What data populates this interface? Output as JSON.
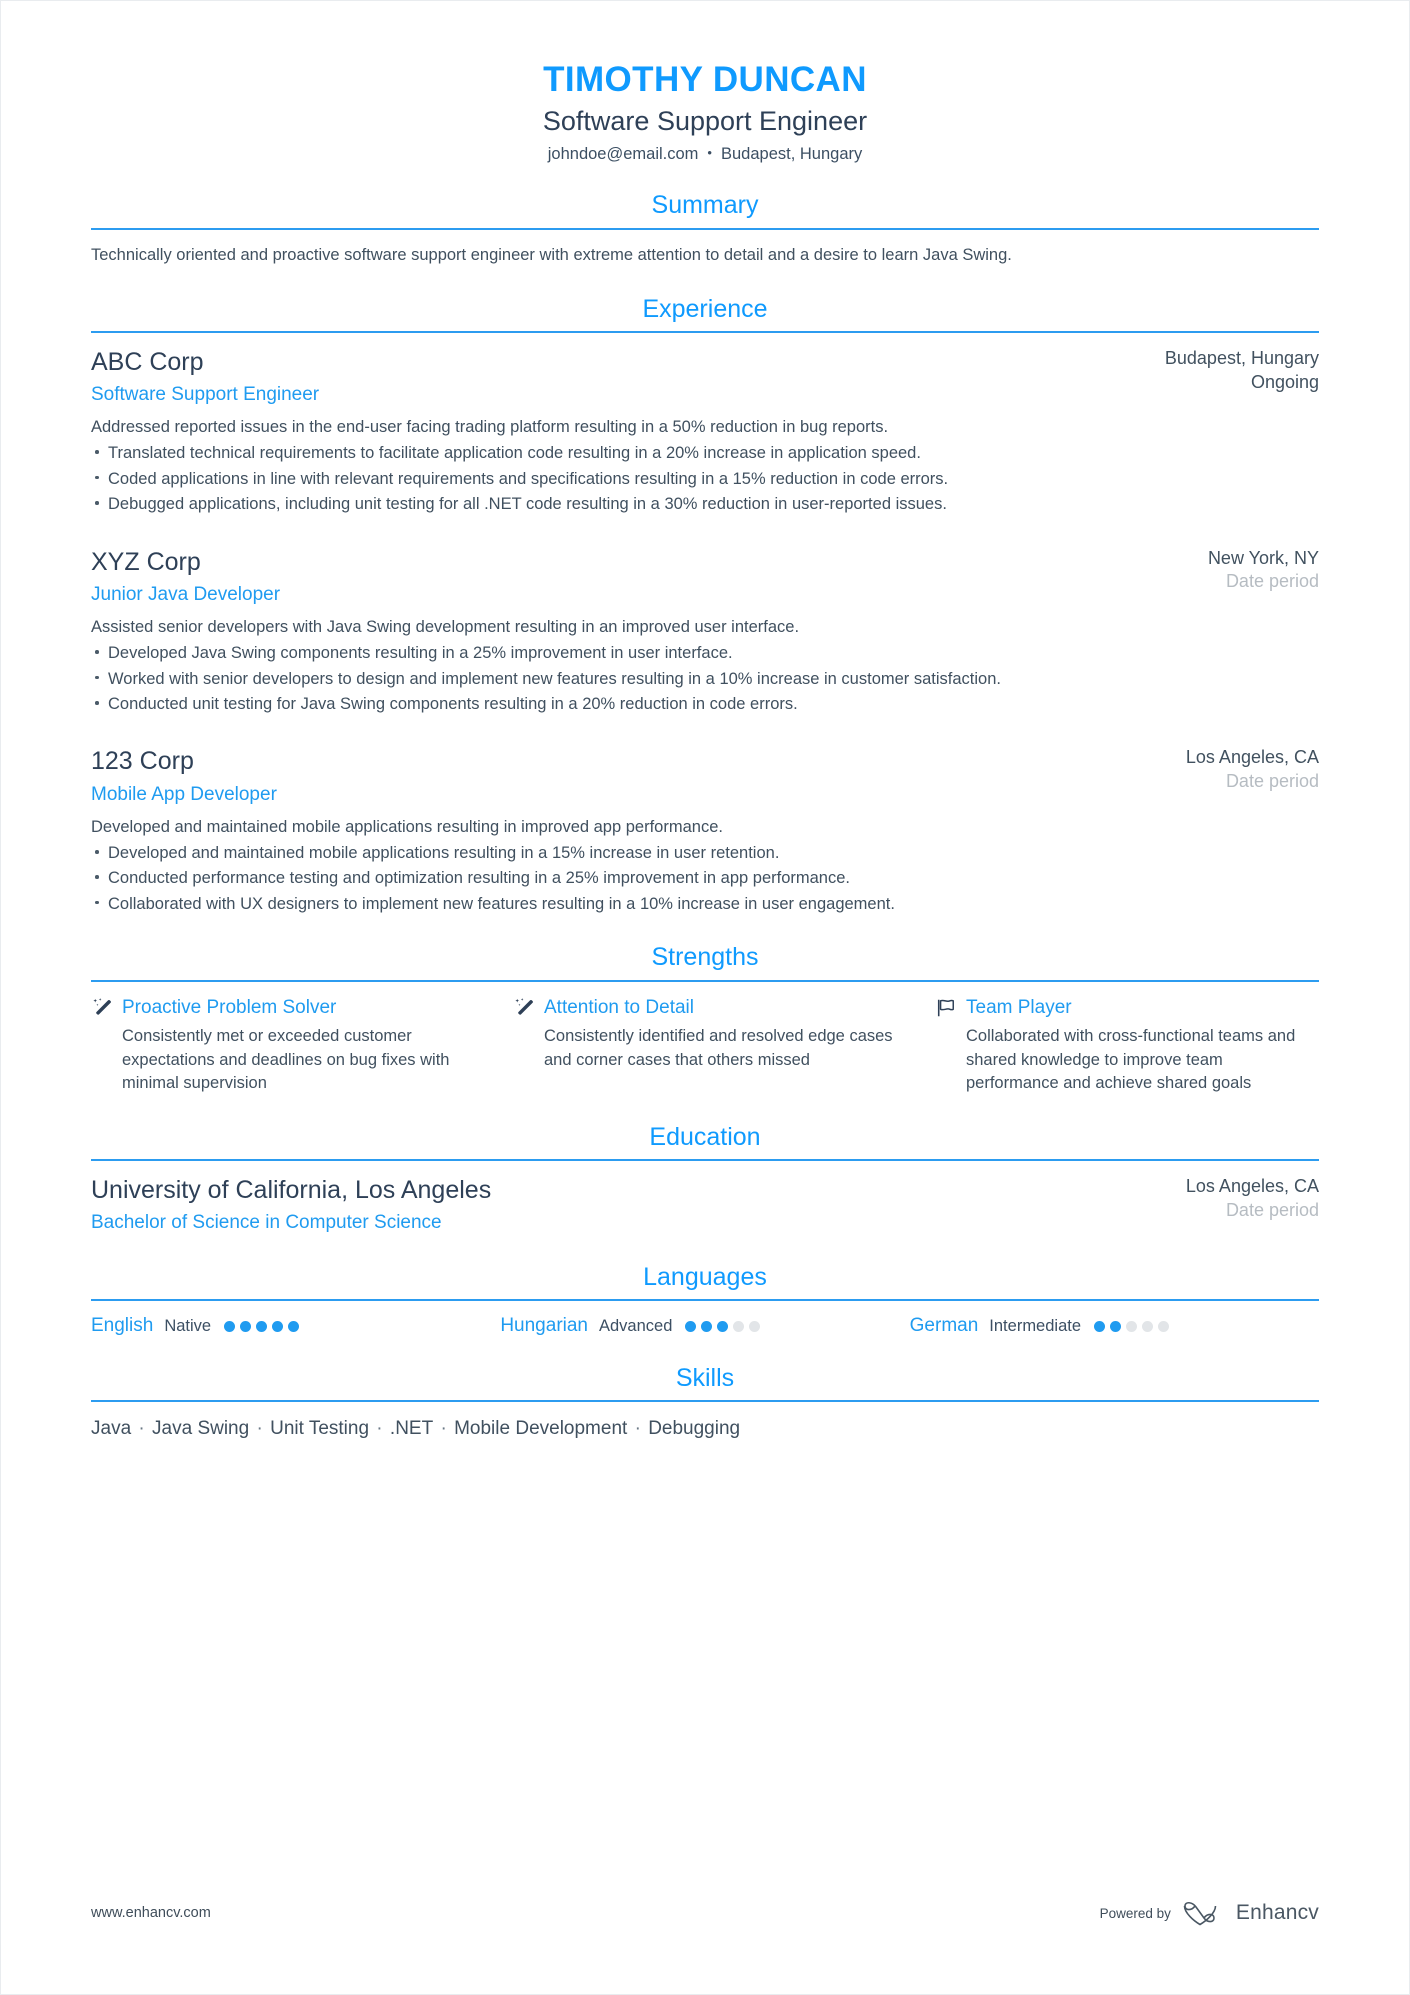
{
  "header": {
    "name": "TIMOTHY DUNCAN",
    "role": "Software Support Engineer",
    "email": "johndoe@email.com",
    "separator": "•",
    "location": "Budapest, Hungary"
  },
  "sections": {
    "summary": "Summary",
    "experience": "Experience",
    "strengths": "Strengths",
    "education": "Education",
    "languages": "Languages",
    "skills": "Skills"
  },
  "summary": {
    "text": "Technically oriented and proactive software support engineer with extreme attention to detail and a desire to learn Java Swing."
  },
  "experience": [
    {
      "org": "ABC Corp",
      "role": "Software Support Engineer",
      "location": "Budapest, Hungary",
      "date": "Ongoing",
      "date_muted": false,
      "desc": "Addressed reported issues in the end-user facing trading platform resulting in a 50% reduction in bug reports.",
      "bullets": [
        "Translated technical requirements to facilitate application code resulting in a 20% increase in application speed.",
        "Coded applications in line with relevant requirements and specifications resulting in a 15% reduction in code errors.",
        "Debugged applications, including unit testing for all .NET code resulting in a 30% reduction in user-reported issues."
      ]
    },
    {
      "org": "XYZ Corp",
      "role": "Junior Java Developer",
      "location": "New York, NY",
      "date": "Date period",
      "date_muted": true,
      "desc": "Assisted senior developers with Java Swing development resulting in an improved user interface.",
      "bullets": [
        "Developed Java Swing components resulting in a 25% improvement in user interface.",
        "Worked with senior developers to design and implement new features resulting in a 10% increase in customer satisfaction.",
        "Conducted unit testing for Java Swing components resulting in a 20% reduction in code errors."
      ]
    },
    {
      "org": "123 Corp",
      "role": "Mobile App Developer",
      "location": "Los Angeles, CA",
      "date": "Date period",
      "date_muted": true,
      "desc": "Developed and maintained mobile applications resulting in improved app performance.",
      "bullets": [
        "Developed and maintained mobile applications resulting in a 15% increase in user retention.",
        "Conducted performance testing and optimization resulting in a 25% improvement in app performance.",
        "Collaborated with UX designers to implement new features resulting in a 10% increase in user engagement."
      ]
    }
  ],
  "strengths": [
    {
      "icon": "magic-wand-icon",
      "title": "Proactive Problem Solver",
      "desc": "Consistently met or exceeded customer expectations and deadlines on bug fixes with minimal supervision"
    },
    {
      "icon": "magic-wand-icon",
      "title": "Attention to Detail",
      "desc": "Consistently identified and resolved edge cases and corner cases that others missed"
    },
    {
      "icon": "flag-icon",
      "title": "Team Player",
      "desc": "Collaborated with cross-functional teams and shared knowledge to improve team performance and achieve shared goals"
    }
  ],
  "education": [
    {
      "org": "University of California, Los Angeles",
      "role": "Bachelor of Science in Computer Science",
      "location": "Los Angeles, CA",
      "date": "Date period",
      "date_muted": true
    }
  ],
  "languages": [
    {
      "name": "English",
      "level": "Native",
      "filled": 5,
      "total": 5
    },
    {
      "name": "Hungarian",
      "level": "Advanced",
      "filled": 3,
      "total": 5
    },
    {
      "name": "German",
      "level": "Intermediate",
      "filled": 2,
      "total": 5
    }
  ],
  "skills": {
    "items": [
      "Java",
      "Java Swing",
      "Unit Testing",
      ".NET",
      "Mobile Development",
      "Debugging"
    ],
    "separator": "·"
  },
  "footer": {
    "url": "www.enhancv.com",
    "powered_by": "Powered by",
    "brand": "Enhancv"
  },
  "colors": {
    "accent": "#0f9afe",
    "rule": "#2c9cf0",
    "text": "#40505f",
    "heading": "#2e4057",
    "muted": "#b6bcc2"
  }
}
